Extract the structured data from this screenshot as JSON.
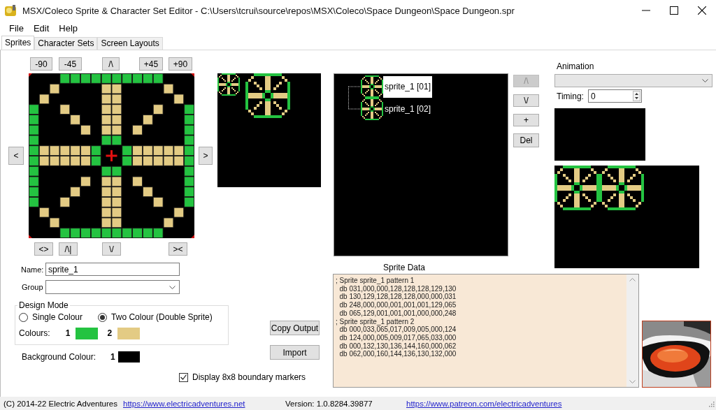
{
  "window": {
    "title": "MSX/Coleco Sprite & Character Set Editor - C:\\Users\\tcrui\\source\\repos\\MSX\\Coleco\\Space Dungeon\\Space Dungeon.spr"
  },
  "menu": [
    {
      "label": "File"
    },
    {
      "label": "Edit"
    },
    {
      "label": "Help"
    }
  ],
  "tabs": [
    {
      "label": "Sprites",
      "selected": true
    },
    {
      "label": "Character Sets",
      "selected": false
    },
    {
      "label": "Screen Layouts",
      "selected": false
    }
  ],
  "editor": {
    "rotate_buttons": [
      "-90",
      "-45",
      "/\\",
      "+45",
      "+90"
    ],
    "shift_left": "<",
    "shift_right": ">",
    "flip_buttons": [
      "<>",
      "/\\|",
      "\\/",
      "><"
    ]
  },
  "name": {
    "label": "Name:",
    "value": "sprite_1"
  },
  "group": {
    "label": "Group"
  },
  "design_mode": {
    "title": "Design Mode",
    "options": [
      {
        "label": "Single Colour",
        "selected": false
      },
      {
        "label": "Two Colour (Double Sprite)",
        "selected": true
      }
    ],
    "colours_label": "Colours:",
    "colours": [
      {
        "label": "1",
        "color": "#24c341"
      },
      {
        "label": "2",
        "color": "#e3cb84"
      }
    ]
  },
  "background_colour": {
    "label": "Background Colour:",
    "number": "1",
    "color": "#000000"
  },
  "boundary_markers": {
    "label": "Display 8x8 boundary markers",
    "checked": true
  },
  "output_buttons": [
    "Copy Output",
    "Import"
  ],
  "sprite_list": {
    "items": [
      {
        "label": "sprite_1 [01]",
        "selected": true
      },
      {
        "label": "sprite_1 [02]",
        "selected": false
      }
    ],
    "buttons": [
      {
        "label": "/\\",
        "disabled": true
      },
      {
        "label": "\\/",
        "disabled": false
      },
      {
        "label": "+",
        "disabled": false
      },
      {
        "label": "Del",
        "disabled": false
      }
    ]
  },
  "sprite_data": {
    "title": "Sprite Data",
    "lines": [
      "; Sprite sprite_1 pattern 1",
      "  db 031,000,000,128,128,128,129,130",
      "  db 130,129,128,128,128,000,000,031",
      "  db 248,000,000,001,001,001,129,065",
      "  db 065,129,001,001,001,000,000,248",
      "; Sprite sprite_1 pattern 2",
      "  db 000,033,065,017,009,005,000,124",
      "  db 124,000,005,009,017,065,033,000",
      "  db 000,132,130,136,144,160,000,062",
      "  db 062,000,160,144,136,130,132,000"
    ]
  },
  "animation": {
    "label": "Animation",
    "timing_label": "Timing:",
    "timing_value": "0"
  },
  "status_bar": {
    "copyright": "(C) 2014-22 Electric Adventures",
    "website": "https://www.electricadventures.net",
    "version": "Version: 1.0.8284.39877",
    "patreon": "https://www.patreon.com/electricadventures"
  }
}
